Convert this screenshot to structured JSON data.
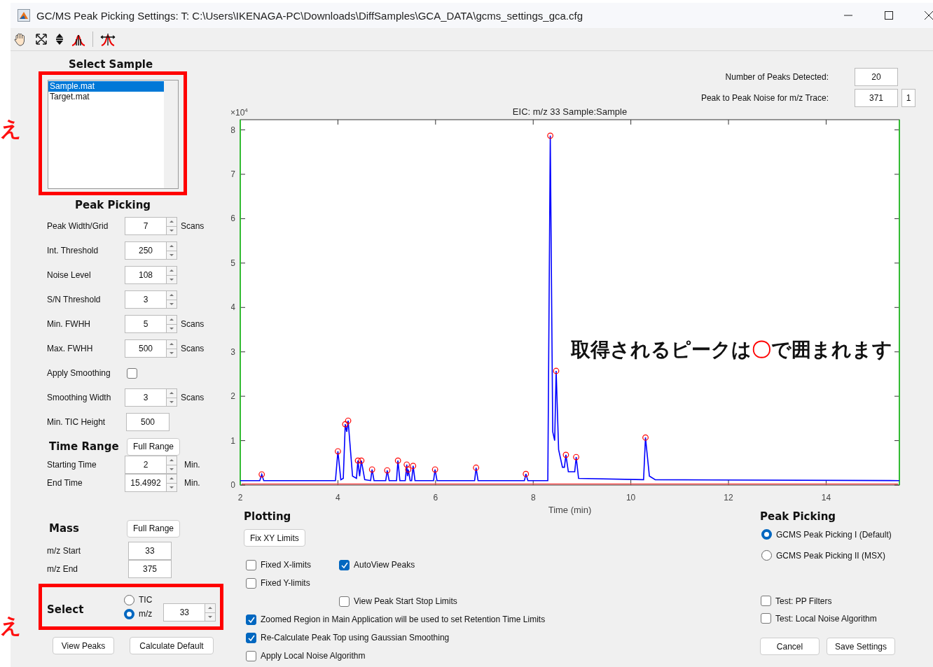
{
  "window": {
    "title": "GC/MS Peak Picking Settings: T: C:\\Users\\IKENAGA-PC\\Downloads\\DiffSamples\\GCA_DATA\\gcms_settings_gca.cfg"
  },
  "annotation": {
    "marks": [
      "え",
      "え"
    ],
    "callout": [
      {
        "text": "取得されるピークは"
      },
      {
        "text": "〇",
        "color": "#ff0000"
      },
      {
        "text": "で囲まれます"
      }
    ]
  },
  "select_sample": {
    "title": "Select Sample",
    "highlighted": true,
    "items": [
      {
        "label": "Sample.mat",
        "selected": true
      },
      {
        "label": "Target.mat",
        "selected": false
      }
    ]
  },
  "peak_picking": {
    "title": "Peak Picking",
    "rows": [
      {
        "kind": "spin",
        "label": "Peak Width/Grid",
        "value": "7",
        "unit": "Scans"
      },
      {
        "kind": "spin",
        "label": "Int. Threshold",
        "value": "250"
      },
      {
        "kind": "spin",
        "label": "Noise Level",
        "value": "108"
      },
      {
        "kind": "spin",
        "label": "S/N Threshold",
        "value": "3"
      },
      {
        "kind": "spin",
        "label": "Min. FWHH",
        "value": "5",
        "unit": "Scans"
      },
      {
        "kind": "spin",
        "label": "Max. FWHH",
        "value": "500",
        "unit": "Scans"
      },
      {
        "kind": "checkbox",
        "label": "Apply Smoothing",
        "checked": false
      },
      {
        "kind": "spin",
        "label": "Smoothing Width",
        "value": "3",
        "unit": "Scans"
      },
      {
        "kind": "field",
        "label": "Min. TIC Height",
        "value": "500"
      }
    ]
  },
  "time_range": {
    "title": "Time Range",
    "button": "Full Range",
    "rows": [
      {
        "label": "Starting Time",
        "value": "2",
        "unit": "Min."
      },
      {
        "label": "End Time",
        "value": "15.4992",
        "unit": "Min."
      }
    ]
  },
  "mass": {
    "title": "Mass",
    "button": "Full Range",
    "rows": [
      {
        "label": "m/z Start",
        "value": "33"
      },
      {
        "label": "m/z End",
        "value": "375"
      }
    ]
  },
  "select": {
    "title": "Select",
    "highlighted": true,
    "options": [
      {
        "label": "TIC",
        "selected": false
      },
      {
        "label": "m/z",
        "selected": true
      }
    ],
    "value": "33"
  },
  "buttons": [
    "View Peaks",
    "Calculate Default"
  ],
  "stats": [
    {
      "label": "Number of Peaks Detected:",
      "value": "20"
    },
    {
      "label": "Peak to Peak Noise for m/z Trace:",
      "value": "371",
      "extra": "1"
    }
  ],
  "chart": {
    "y_multiplier": {
      "base": "×10",
      "exponent": "4"
    },
    "chart_data": {
      "type": "line",
      "title": "EIC: m/z  33 Sample:Sample",
      "xlabel": "Time (min)",
      "xlim": [
        2,
        15.5
      ],
      "ylim": [
        0,
        8.23
      ],
      "xticks": [
        2,
        4,
        6,
        8,
        10,
        12,
        14
      ],
      "yticks": [
        0,
        1,
        2,
        3,
        4,
        5,
        6,
        7,
        8
      ],
      "x": [
        2,
        2.4,
        2.44,
        2.48,
        3.95,
        4.0,
        4.06,
        4.11,
        4.15,
        4.18,
        4.21,
        4.3,
        4.38,
        4.41,
        4.445,
        4.48,
        4.55,
        4.67,
        4.7,
        4.74,
        4.98,
        5.01,
        5.05,
        5.2,
        5.23,
        5.27,
        5.38,
        5.41,
        5.425,
        5.44,
        5.48,
        5.51,
        5.54,
        5.58,
        5.96,
        5.99,
        6.03,
        6.8,
        6.83,
        6.87,
        7.82,
        7.85,
        7.89,
        8.3,
        8.35,
        8.4,
        8.44,
        8.47,
        8.52,
        8.6,
        8.64,
        8.67,
        8.72,
        8.85,
        8.88,
        8.93,
        10.26,
        10.3,
        10.38,
        10.5,
        15.5
      ],
      "series": [
        {
          "color": "#0000ff",
          "values": [
            0.1,
            0.1,
            0.24,
            0.1,
            0.1,
            0.76,
            0.12,
            0.15,
            1.37,
            1.2,
            1.45,
            0.2,
            0.15,
            0.55,
            0.2,
            0.55,
            0.12,
            0.1,
            0.35,
            0.1,
            0.1,
            0.33,
            0.1,
            0.1,
            0.55,
            0.1,
            0.1,
            0.46,
            0.2,
            0.35,
            0.1,
            0.1,
            0.43,
            0.1,
            0.1,
            0.35,
            0.1,
            0.1,
            0.39,
            0.1,
            0.1,
            0.25,
            0.1,
            0.1,
            7.87,
            1.2,
            1.0,
            2.57,
            0.8,
            0.4,
            0.4,
            0.68,
            0.3,
            0.3,
            0.63,
            0.15,
            0.12,
            1.07,
            0.2,
            0.12,
            0.1
          ]
        }
      ]
    }
  },
  "plotting": {
    "title": "Plotting",
    "button": "Fix XY Limits",
    "limit_options": [
      {
        "label": "Fixed X-limits",
        "checked": false
      },
      {
        "label": "Fixed Y-limits",
        "checked": false
      }
    ],
    "view_options": [
      {
        "label": "AutoView Peaks",
        "checked": true
      },
      {
        "label": "View Peak Start Stop Limits",
        "checked": false
      }
    ],
    "other_options": [
      {
        "label": "Zoomed Region in Main Application will be used to set Retention Time Limits",
        "checked": true
      },
      {
        "label": "Re-Calculate Peak Top using Gaussian Smoothing",
        "checked": true
      },
      {
        "label": "Apply Local Noise Algorithm",
        "checked": false
      }
    ]
  },
  "method": {
    "title": "Peak Picking",
    "options": [
      {
        "label": "GCMS Peak Picking I (Default)",
        "selected": true
      },
      {
        "label": "GCMS Peak Picking II (MSX)",
        "selected": false
      }
    ],
    "tests": [
      {
        "label": "Test: PP Filters",
        "checked": false
      },
      {
        "label": "Test: Local Noise Algorithm",
        "checked": false
      }
    ],
    "buttons": [
      "Cancel",
      "Save Settings"
    ]
  }
}
